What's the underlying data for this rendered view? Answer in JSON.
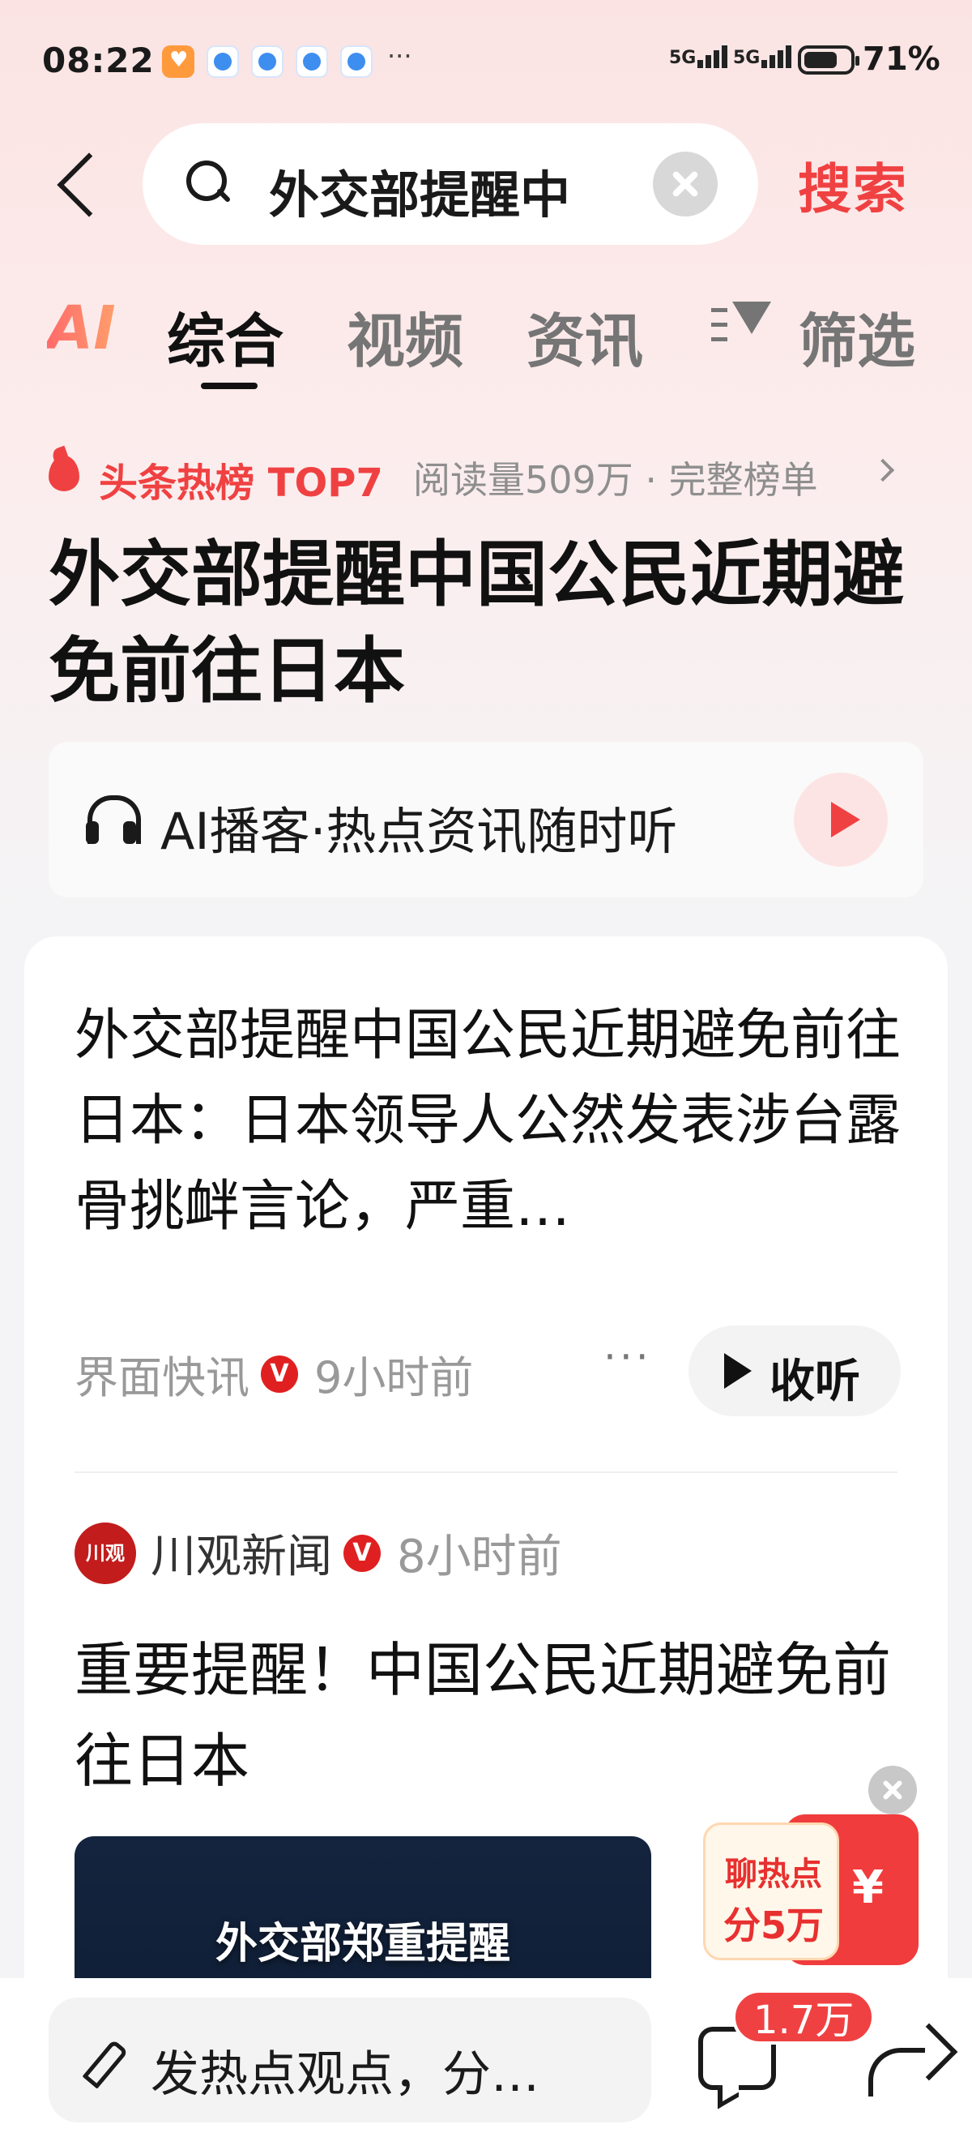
{
  "status_bar": {
    "time": "08:22",
    "signal1": "5G",
    "signal2": "5G",
    "battery": "71%",
    "more": "···"
  },
  "search": {
    "query": "外交部提醒中",
    "submit_label": "搜索"
  },
  "tabs": {
    "ai": "AI",
    "items": [
      {
        "label": "综合",
        "active": true
      },
      {
        "label": "视频",
        "active": false
      },
      {
        "label": "资讯",
        "active": false
      }
    ],
    "filter_label": "筛选"
  },
  "hot_rank": {
    "label": "头条热榜 TOP7",
    "meta": "阅读量509万 · 完整榜单",
    "headline": "外交部提醒中国公民近期避免前往日本"
  },
  "podcast": {
    "label": "AI播客·热点资讯随时听"
  },
  "results": [
    {
      "title": "外交部提醒中国公民近期避免前往日本：日本领导人公然发表涉台露骨挑衅言论，严重…",
      "source": "界面快讯",
      "verified": "V",
      "time": "9小时前",
      "more": "···",
      "listen_label": "收听"
    },
    {
      "logo_text": "川观",
      "source": "川观新闻",
      "verified": "V",
      "time": "8小时前",
      "title": "重要提醒！中国公民近期避免前往日本",
      "thumbnail_text": "外交部郑重提醒"
    }
  ],
  "promo": {
    "line1": "聊热点",
    "line2": "分5万",
    "yen": "¥"
  },
  "bottom_bar": {
    "comment_placeholder": "发热点观点，分…",
    "comment_count": "1.7万"
  },
  "colors": {
    "accent": "#f04142",
    "text": "#111111",
    "muted": "#999999"
  }
}
